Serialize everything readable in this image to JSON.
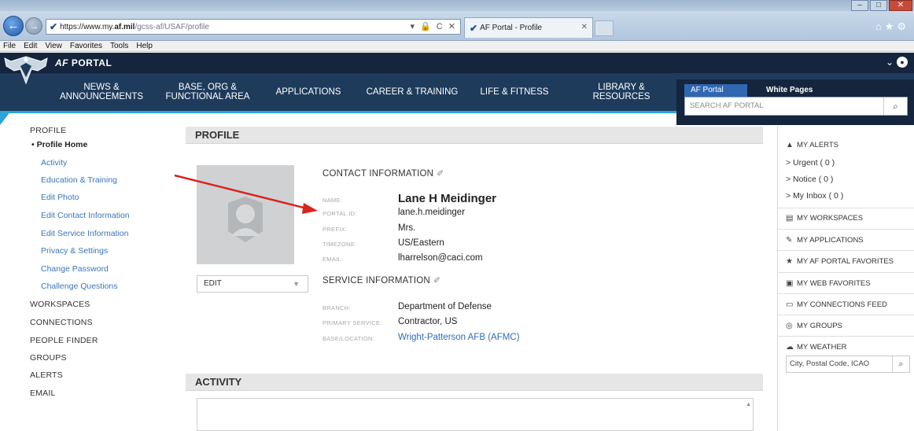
{
  "browser": {
    "url_prefix": "https://www.my.",
    "url_domain": "af.mil",
    "url_path": "/gcss-af/USAF/profile",
    "url_controls": "▾ 🔒 C ✕",
    "tab_title": "AF Portal - Profile",
    "menu": [
      "File",
      "Edit",
      "View",
      "Favorites",
      "Tools",
      "Help"
    ]
  },
  "portal": {
    "title_prefix": "AF",
    "title_suffix": " PORTAL",
    "nav": [
      {
        "line1": "NEWS &",
        "line2": "ANNOUNCEMENTS"
      },
      {
        "line1": "BASE, ORG &",
        "line2": "FUNCTIONAL AREA"
      },
      {
        "line1": "APPLICATIONS",
        "line2": ""
      },
      {
        "line1": "CAREER & TRAINING",
        "line2": ""
      },
      {
        "line1": "LIFE & FITNESS",
        "line2": ""
      },
      {
        "line1": "LIBRARY &",
        "line2": "RESOURCES"
      }
    ],
    "search_tabs": [
      "AF Portal",
      "White Pages"
    ],
    "search_placeholder": "SEARCH AF PORTAL"
  },
  "leftnav": {
    "profile": "PROFILE",
    "profile_home": "• Profile Home",
    "sub_items": [
      "Activity",
      "Education & Training",
      "Edit Photo",
      "Edit Contact Information",
      "Edit Service Information",
      "Privacy & Settings",
      "Change Password",
      "Challenge Questions"
    ],
    "top_items": [
      "WORKSPACES",
      "CONNECTIONS",
      "PEOPLE FINDER",
      "GROUPS",
      "ALERTS",
      "EMAIL"
    ]
  },
  "profile": {
    "header": "PROFILE",
    "edit_select": "EDIT",
    "contact_title": "CONTACT INFORMATION",
    "contact_fields": [
      {
        "label": "NAME:",
        "value": "Lane H Meidinger"
      },
      {
        "label": "PORTAL ID:",
        "value": "lane.h.meidinger"
      },
      {
        "label": "PREFIX:",
        "value": "Mrs."
      },
      {
        "label": "TIMEZONE:",
        "value": "US/Eastern"
      },
      {
        "label": "EMAIL:",
        "value": "lharrelson@caci.com"
      }
    ],
    "service_title": "SERVICE INFORMATION",
    "service_fields": [
      {
        "label": "BRANCH:",
        "value": "Department of Defense"
      },
      {
        "label": "PRIMARY SERVICE:",
        "value": "Contractor, US"
      },
      {
        "label": "BASE/LOCATION:",
        "value": "Wright-Patterson AFB (AFMC)"
      }
    ]
  },
  "activity": {
    "header": "ACTIVITY"
  },
  "rightcol": {
    "alerts": "MY ALERTS",
    "alert_items": [
      "> Urgent ( 0 )",
      "> Notice ( 0 )",
      "> My Inbox ( 0 )"
    ],
    "items": [
      "MY WORKSPACES",
      "MY APPLICATIONS",
      "MY AF PORTAL FAVORITES",
      "MY WEB FAVORITES",
      "MY CONNECTIONS FEED",
      "MY GROUPS",
      "MY WEATHER"
    ],
    "weather_placeholder": "City, Postal Code, ICAO"
  }
}
